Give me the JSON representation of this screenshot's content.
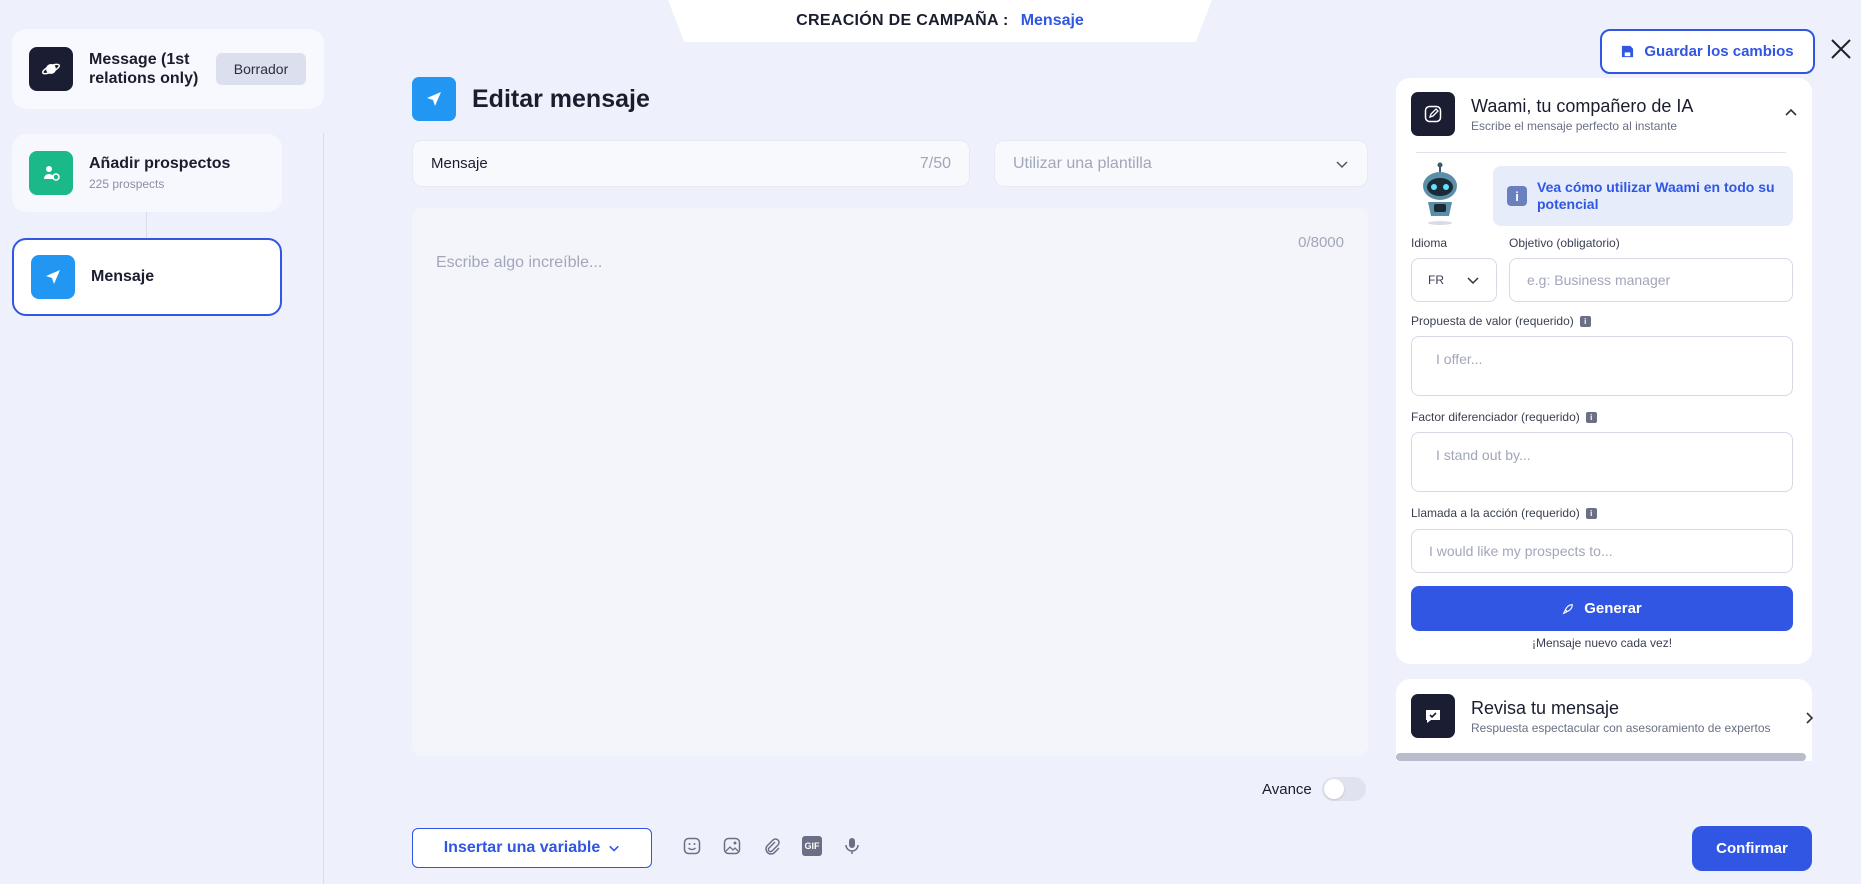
{
  "header": {
    "label": "CREACIÓN DE CAMPAÑA :",
    "value": "Mensaje"
  },
  "save_button": "Guardar los cambios",
  "steps": [
    {
      "title": "Message (1st relations only)",
      "badge": "Borrador"
    },
    {
      "title": "Añadir prospectos",
      "subtitle": "225 prospects"
    },
    {
      "title": "Mensaje"
    }
  ],
  "editor": {
    "title": "Editar mensaje",
    "subject_value": "Mensaje",
    "subject_count": "7/50",
    "template_placeholder": "Utilizar una plantilla",
    "body_count": "0/8000",
    "body_placeholder": "Escribe algo increíble...",
    "avance_label": "Avance",
    "insert_variable": "Insertar una variable",
    "confirm": "Confirmar"
  },
  "ai": {
    "title": "Waami, tu compañero de IA",
    "subtitle": "Escribe el mensaje perfecto al instante",
    "info": "Vea cómo utilizar Waami en todo su potencial",
    "language_label": "Idioma",
    "language_value": "FR",
    "objective_label": "Objetivo (obligatorio)",
    "objective_placeholder": "e.g: Business manager",
    "value_prop_label": "Propuesta de valor (requerido)",
    "value_prop_placeholder": "I offer...",
    "diff_label": "Factor diferenciador (requerido)",
    "diff_placeholder": "I stand out by...",
    "cta_label": "Llamada a la acción (requerido)",
    "cta_placeholder": "I would like my prospects to...",
    "generate": "Generar",
    "generate_note": "¡Mensaje nuevo cada vez!"
  },
  "review": {
    "title": "Revisa tu mensaje",
    "subtitle": "Respuesta espectacular con asesoramiento de expertos"
  },
  "colors": {
    "primary": "#3056e3",
    "dark": "#1b1e33",
    "green": "#1bb889",
    "blue": "#2196f3"
  }
}
